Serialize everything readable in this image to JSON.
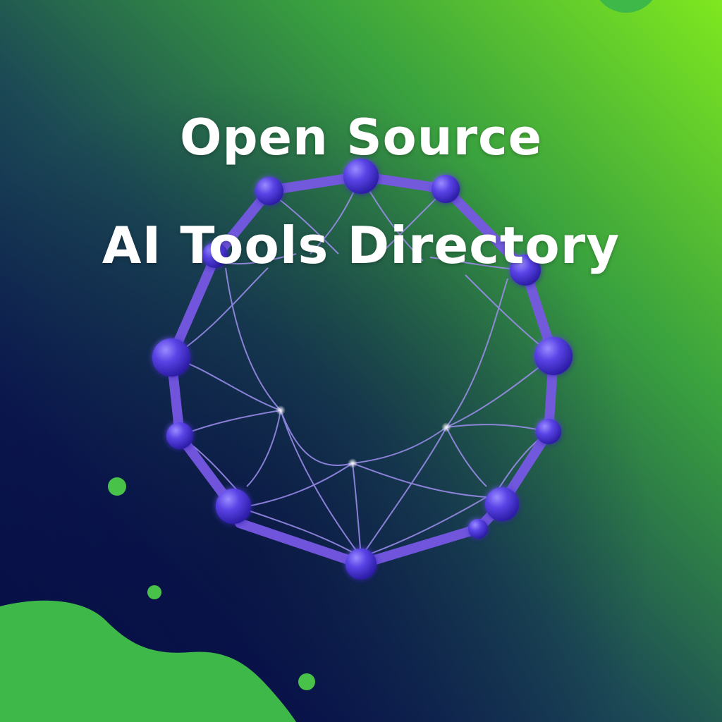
{
  "hero": {
    "title_line1": "Open Source",
    "title_line2": "AI Tools Directory"
  },
  "colors": {
    "background_dark": "#060f45",
    "background_light": "#7fe81f",
    "ring": "#7c5ce6",
    "node": "#5b45e0",
    "blob": "#3fb84a",
    "title": "#ffffff"
  },
  "icons": {
    "ring": "network-ring-graphic",
    "blob": "green-blob-shape",
    "dots": "green-dot-decoration"
  }
}
